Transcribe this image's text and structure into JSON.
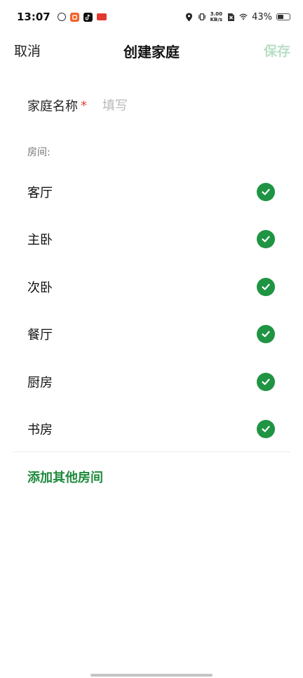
{
  "status_bar": {
    "time": "13:07",
    "net_speed_value": "3.00",
    "net_speed_unit": "KB/s",
    "battery_percent": "43%",
    "app_icons": [
      "leaf-app-icon",
      "orange-app-icon",
      "tiktok-icon",
      "red-app-icon"
    ],
    "right_icons": [
      "location-icon",
      "vibrate-icon",
      "no-sim-icon",
      "wifi-icon",
      "battery-icon"
    ]
  },
  "header": {
    "cancel_label": "取消",
    "title": "创建家庭",
    "save_label": "保存"
  },
  "form": {
    "name_label": "家庭名称",
    "required_mark": "*",
    "name_placeholder": "填写",
    "name_value": ""
  },
  "rooms": {
    "section_label": "房间:",
    "items": [
      {
        "label": "客厅",
        "checked": true
      },
      {
        "label": "主卧",
        "checked": true
      },
      {
        "label": "次卧",
        "checked": true
      },
      {
        "label": "餐厅",
        "checked": true
      },
      {
        "label": "厨房",
        "checked": true
      },
      {
        "label": "书房",
        "checked": true
      }
    ],
    "add_label": "添加其他房间"
  },
  "colors": {
    "accent_green": "#1f9443",
    "save_disabled": "#b9dfc5",
    "required_red": "#e5453b"
  }
}
